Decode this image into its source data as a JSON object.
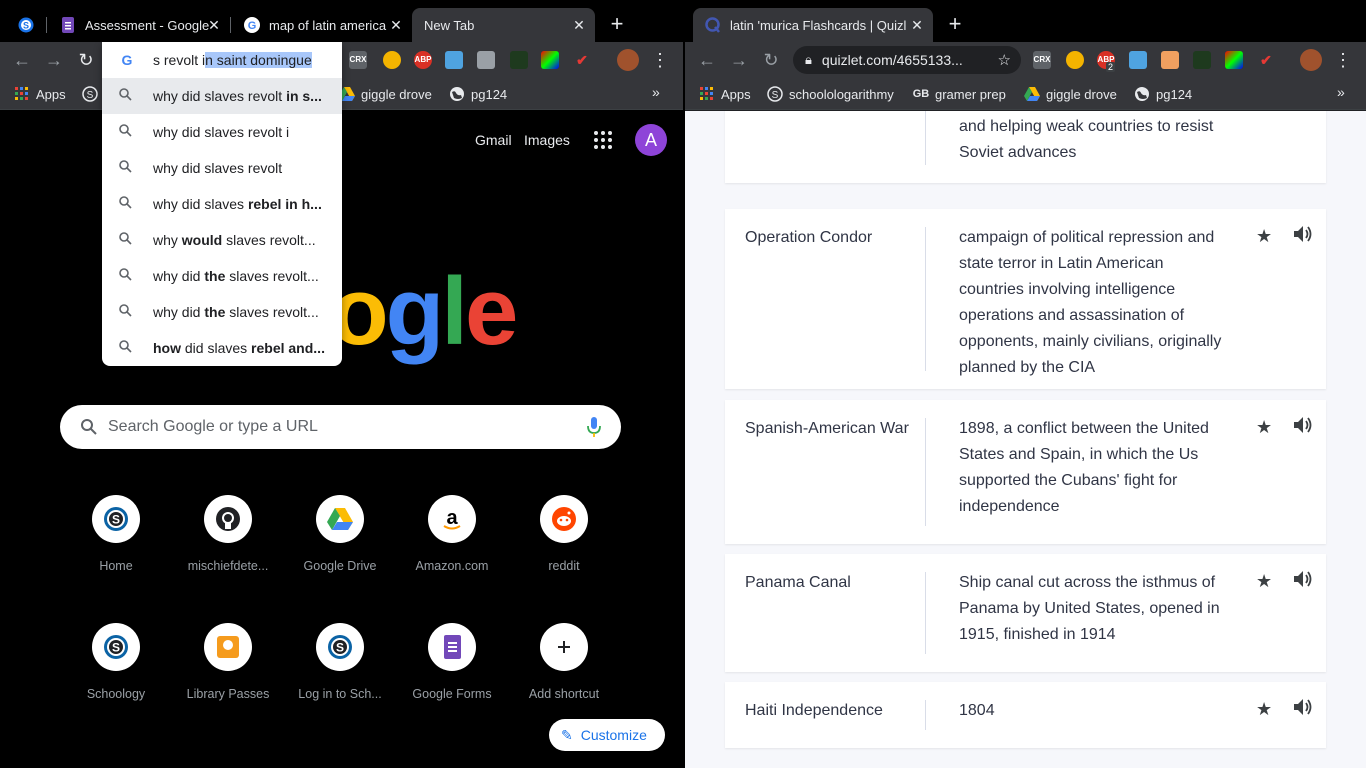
{
  "left_window": {
    "tabs": [
      {
        "title": "",
        "icon": "schoology-icon"
      },
      {
        "title": "Assessment - Google",
        "icon": "google-forms-icon"
      },
      {
        "title": "map of latin america",
        "icon": "google-icon"
      },
      {
        "title": "New Tab",
        "icon": ""
      }
    ],
    "omnibox": {
      "typed": "s revolt i",
      "autocomplete": "n saint domingue"
    },
    "suggestions": [
      {
        "normal": "why did slaves revolt ",
        "bold": "in s..."
      },
      {
        "normal": "why did slaves revolt i",
        "bold": ""
      },
      {
        "normal": "why did slaves revolt",
        "bold": ""
      },
      {
        "normal": "why did slaves ",
        "bold": "rebel in h..."
      },
      {
        "normal": "why ",
        "bold": "would",
        "normal2": " slaves revolt..."
      },
      {
        "normal": "why did ",
        "bold": "the",
        "normal2": " slaves revolt..."
      },
      {
        "normal": "why did ",
        "bold": "the",
        "normal2": " slaves revolt..."
      },
      {
        "normal": "",
        "bold": "how",
        "normal2": " did slaves ",
        "bold2": "rebel and..."
      }
    ],
    "bookmarks": [
      {
        "label": "Apps",
        "icon": "apps-grid-icon"
      },
      {
        "label": "giggle drove",
        "icon": "google-drive-icon"
      },
      {
        "label": "pg124",
        "icon": "globe-icon"
      }
    ],
    "ntp": {
      "gmail": "Gmail",
      "images": "Images",
      "avatar": "A",
      "logo_visible": "ogle",
      "search_placeholder": "Search Google or type a URL",
      "shortcuts_row1": [
        {
          "label": "Home",
          "icon": "schoology-icon"
        },
        {
          "label": "mischiefdete...",
          "icon": "github-icon"
        },
        {
          "label": "Google Drive",
          "icon": "google-drive-icon"
        },
        {
          "label": "Amazon.com",
          "icon": "amazon-icon"
        },
        {
          "label": "reddit",
          "icon": "reddit-icon"
        }
      ],
      "shortcuts_row2": [
        {
          "label": "Schoology",
          "icon": "schoology-icon"
        },
        {
          "label": "Library Passes",
          "icon": "library-pass-icon"
        },
        {
          "label": "Log in to Sch...",
          "icon": "schoology-icon"
        },
        {
          "label": "Google Forms",
          "icon": "google-forms-icon"
        },
        {
          "label": "Add shortcut",
          "icon": "plus-icon"
        }
      ],
      "customize": "Customize"
    }
  },
  "right_window": {
    "tabs": [
      {
        "title": "latin 'murica Flashcards | Quizl",
        "icon": "quizlet-icon"
      }
    ],
    "url": "quizlet.com/4655133...",
    "bookmarks": [
      {
        "label": "Apps",
        "icon": "apps-grid-icon"
      },
      {
        "label": "schoolologarithmy",
        "icon": "schoology-icon"
      },
      {
        "label": "gramer prep",
        "icon": "gb-icon"
      },
      {
        "label": "giggle drove",
        "icon": "google-drive-icon"
      },
      {
        "label": "pg124",
        "icon": "globe-icon"
      }
    ],
    "cards": [
      {
        "term": "",
        "definition": "and helping weak countries to resist Soviet advances"
      },
      {
        "term": "Operation Condor",
        "definition": "campaign of political repression and state terror in Latin American countries involving intelligence operations and assassination of opponents, mainly civilians, originally planned by the CIA"
      },
      {
        "term": "Spanish-American War",
        "definition": "1898, a conflict between the United States and Spain, in which the Us supported the Cubans' fight for independence"
      },
      {
        "term": "Panama Canal",
        "definition": "Ship canal cut across the isthmus of Panama by United States, opened in 1915, finished in 1914"
      },
      {
        "term": "Haiti Independence",
        "definition": "1804"
      }
    ]
  },
  "extensions": {
    "crx": "CRX",
    "abp": "ABP",
    "abp_badge": "2"
  },
  "colors": {
    "accent_blue": "#1a73e8",
    "avatar_purple": "#8e44d8",
    "chrome_dark": "#35363a"
  }
}
